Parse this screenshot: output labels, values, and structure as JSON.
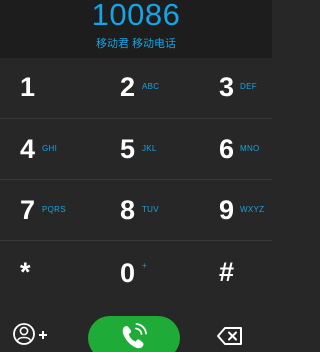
{
  "display": {
    "number": "10086",
    "caller": "移动君 移动电话"
  },
  "keys": [
    {
      "digit": "1",
      "letters": ""
    },
    {
      "digit": "2",
      "letters": "ABC"
    },
    {
      "digit": "3",
      "letters": "DEF"
    },
    {
      "digit": "4",
      "letters": "GHI"
    },
    {
      "digit": "5",
      "letters": "JKL"
    },
    {
      "digit": "6",
      "letters": "MNO"
    },
    {
      "digit": "7",
      "letters": "PQRS"
    },
    {
      "digit": "8",
      "letters": "TUV"
    },
    {
      "digit": "9",
      "letters": "WXYZ"
    },
    {
      "digit": "*",
      "letters": ""
    },
    {
      "digit": "0",
      "letters": "+"
    },
    {
      "digit": "#",
      "letters": ""
    }
  ],
  "bottom_bar": {
    "contact_icon": "add-contact-icon",
    "call_icon": "phone-call-icon",
    "delete_icon": "backspace-icon"
  },
  "colors": {
    "accent": "#15a4e6",
    "call": "#1fab37",
    "background": "#272727"
  }
}
